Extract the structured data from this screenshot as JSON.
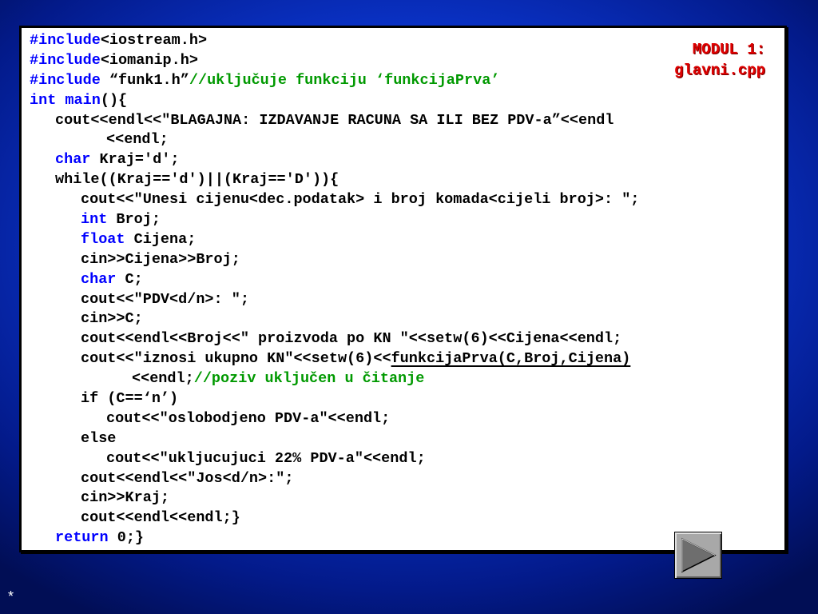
{
  "module_title": {
    "line1": "MODUL 1:",
    "line2": "glavni.cpp"
  },
  "code": {
    "l1": {
      "kw": "#include",
      "rest": "<iostream.h>"
    },
    "l2": {
      "kw": "#include",
      "rest": "<iomanip.h>"
    },
    "l3": {
      "kw": "#include",
      "mid": " “funk1.h”",
      "comment": "//uključuje funkciju ‘funkcijaPrva’"
    },
    "l4": {
      "kw1": "int",
      "sp": " ",
      "kw2": "main",
      "rest": "(){"
    },
    "l5": "cout<<endl<<\"BLAGAJNA: IZDAVANJE RACUNA SA ILI BEZ PDV-a”<<endl",
    "l6": "<<endl;",
    "l7": {
      "kw": "char",
      "rest": " Kraj='d';"
    },
    "l8": "while((Kraj=='d')||(Kraj=='D')){",
    "l9": "cout<<\"Unesi cijenu<dec.podatak> i broj komada<cijeli broj>: \";",
    "l10": {
      "kw": "int",
      "rest": " Broj;"
    },
    "l11": {
      "kw": "float",
      "rest": " Cijena;"
    },
    "l12": "cin>>Cijena>>Broj;",
    "l13": {
      "kw": "char",
      "rest": " C;"
    },
    "l14": "cout<<\"PDV<d/n>: \";",
    "l15": "cin>>C;",
    "l16": "cout<<endl<<Broj<<\" proizvoda po KN \"<<setw(6)<<Cijena<<endl;",
    "l17": {
      "pre": "cout<<\"iznosi ukupno KN\"<<setw(6)<<",
      "call": "funkcijaPrva(C,Broj,Cijena)"
    },
    "l18": {
      "pre": "<<endl;",
      "comment": "//poziv uključen u čitanje"
    },
    "l19": "if (C==‘n’)",
    "l20": "cout<<\"oslobodjeno PDV-a\"<<endl;",
    "l21": "else",
    "l22": "cout<<\"ukljucujuci 22% PDV-a\"<<endl;",
    "l23": "cout<<endl<<\"Jos<d/n>:\";",
    "l24": "cin>>Kraj;",
    "l25": "cout<<endl<<endl;}",
    "l26": {
      "kw": "return",
      "rest": " 0;}"
    }
  },
  "nav": {
    "next_icon": "play-triangle-icon"
  },
  "footer": {
    "star": "*"
  },
  "colors": {
    "keyword": "#0000ff",
    "comment": "#009900",
    "module_title": "#e00000"
  }
}
